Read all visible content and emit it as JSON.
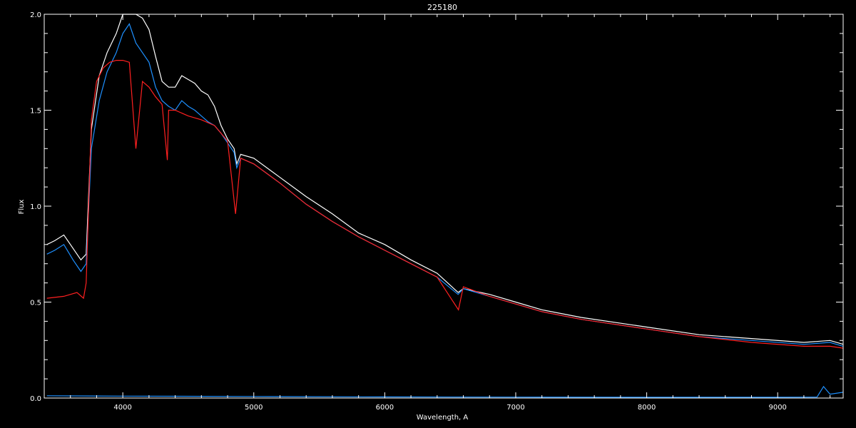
{
  "chart_data": {
    "type": "line",
    "title": "225180",
    "xlabel": "Wavelength, A",
    "ylabel": "Flux",
    "xlim": [
      3400,
      9500
    ],
    "ylim": [
      0,
      2.0
    ],
    "x_ticks": [
      4000,
      5000,
      6000,
      7000,
      8000,
      9000
    ],
    "x_tick_labels": [
      "4000",
      "5000",
      "6000",
      "7000",
      "8000",
      "9000"
    ],
    "y_ticks": [
      0,
      0.5,
      1.0,
      1.5,
      2.0
    ],
    "y_tick_labels": [
      "0.0",
      "0.5",
      "1.0",
      "1.5",
      "2.0"
    ],
    "grid": false,
    "background": "#000000",
    "series": [
      {
        "color": "#ffffff",
        "x": [
          3420,
          3480,
          3550,
          3620,
          3680,
          3720,
          3760,
          3820,
          3880,
          3950,
          4000,
          4050,
          4100,
          4150,
          4200,
          4250,
          4300,
          4350,
          4400,
          4450,
          4500,
          4550,
          4600,
          4650,
          4700,
          4750,
          4800,
          4850,
          4870,
          4900,
          5000,
          5200,
          5400,
          5600,
          5800,
          6000,
          6200,
          6400,
          6560,
          6600,
          6800,
          7000,
          7200,
          7500,
          8000,
          8400,
          8800,
          9200,
          9400,
          9500
        ],
        "y": [
          0.8,
          0.82,
          0.85,
          0.78,
          0.72,
          0.75,
          1.4,
          1.68,
          1.8,
          1.9,
          2.0,
          2.05,
          2.0,
          1.98,
          1.92,
          1.78,
          1.65,
          1.62,
          1.62,
          1.68,
          1.66,
          1.64,
          1.6,
          1.58,
          1.52,
          1.42,
          1.35,
          1.3,
          1.22,
          1.27,
          1.25,
          1.15,
          1.05,
          0.96,
          0.86,
          0.8,
          0.72,
          0.65,
          0.55,
          0.57,
          0.54,
          0.5,
          0.46,
          0.42,
          0.37,
          0.33,
          0.31,
          0.29,
          0.3,
          0.28
        ]
      },
      {
        "color": "#1e90ff",
        "x": [
          3420,
          3480,
          3550,
          3620,
          3680,
          3720,
          3760,
          3820,
          3880,
          3950,
          4000,
          4050,
          4100,
          4150,
          4200,
          4250,
          4300,
          4350,
          4400,
          4450,
          4500,
          4550,
          4600,
          4650,
          4700,
          4750,
          4800,
          4850,
          4870,
          4900,
          5000,
          5200,
          5400,
          5600,
          5800,
          6000,
          6200,
          6400,
          6560,
          6600,
          6800,
          7000,
          7200,
          7500,
          8000,
          8400,
          8800,
          9200,
          9400,
          9500
        ],
        "y": [
          0.75,
          0.77,
          0.8,
          0.72,
          0.66,
          0.7,
          1.3,
          1.55,
          1.7,
          1.8,
          1.9,
          1.95,
          1.85,
          1.8,
          1.75,
          1.62,
          1.55,
          1.52,
          1.5,
          1.55,
          1.52,
          1.5,
          1.47,
          1.44,
          1.42,
          1.38,
          1.33,
          1.28,
          1.2,
          1.25,
          1.22,
          1.12,
          1.01,
          0.92,
          0.84,
          0.77,
          0.7,
          0.63,
          0.54,
          0.57,
          0.53,
          0.49,
          0.45,
          0.41,
          0.36,
          0.32,
          0.3,
          0.28,
          0.29,
          0.27
        ]
      },
      {
        "color": "#ff2020",
        "x": [
          3420,
          3550,
          3650,
          3700,
          3720,
          3760,
          3800,
          3850,
          3900,
          3950,
          4000,
          4050,
          4100,
          4150,
          4200,
          4250,
          4300,
          4340,
          4350,
          4400,
          4500,
          4600,
          4700,
          4800,
          4861,
          4900,
          5000,
          5200,
          5400,
          5600,
          5800,
          6000,
          6200,
          6400,
          6563,
          6600,
          6800,
          7000,
          7200,
          7500,
          8000,
          8400,
          8800,
          9200,
          9400,
          9500
        ],
        "y": [
          0.52,
          0.53,
          0.55,
          0.52,
          0.6,
          1.45,
          1.65,
          1.72,
          1.75,
          1.76,
          1.76,
          1.75,
          1.3,
          1.65,
          1.62,
          1.57,
          1.53,
          1.24,
          1.5,
          1.5,
          1.47,
          1.45,
          1.42,
          1.34,
          0.96,
          1.25,
          1.22,
          1.12,
          1.01,
          0.92,
          0.84,
          0.77,
          0.7,
          0.63,
          0.46,
          0.58,
          0.53,
          0.49,
          0.45,
          0.41,
          0.36,
          0.32,
          0.29,
          0.27,
          0.27,
          0.26
        ]
      },
      {
        "color": "#1e90ff",
        "x": [
          3420,
          4000,
          5000,
          6000,
          7000,
          8000,
          9000,
          9300,
          9350,
          9400,
          9500
        ],
        "y": [
          0.012,
          0.01,
          0.008,
          0.006,
          0.005,
          0.004,
          0.004,
          0.005,
          0.06,
          0.02,
          0.03
        ]
      }
    ]
  }
}
